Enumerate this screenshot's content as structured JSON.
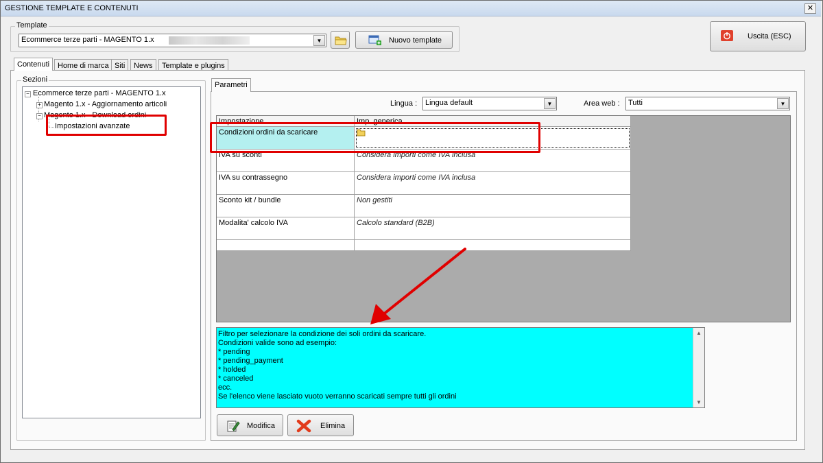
{
  "window": {
    "title": "GESTIONE TEMPLATE E CONTENUTI",
    "close_glyph": "✕"
  },
  "template_group": {
    "legend": "Template",
    "selected": "Ecommerce terze parti - MAGENTO 1.x",
    "new_button": "Nuovo template"
  },
  "exit_button": "Uscita (ESC)",
  "tabs": [
    "Contenuti",
    "Home di marca",
    "Siti",
    "News",
    "Template e plugins"
  ],
  "sections": {
    "legend": "Sezioni",
    "tree": {
      "root": "Ecommerce terze parti - MAGENTO 1.x",
      "child1": "Magento 1.x - Aggiornamento articoli",
      "child2": "Magento 1.x - Download ordini",
      "grandchild": "Impostazioni avanzate"
    }
  },
  "params": {
    "tab": "Parametri",
    "lingua_label": "Lingua :",
    "lingua_value": "Lingua default",
    "area_label": "Area web :",
    "area_value": "Tutti",
    "columns": [
      "Impostazione",
      "Imp. generica"
    ],
    "rows": [
      {
        "name": "Condizioni ordini da scaricare",
        "value": ""
      },
      {
        "name": "IVA su sconti",
        "value": "Considera importi come IVA inclusa"
      },
      {
        "name": "IVA su contrassegno",
        "value": "Considera importi come IVA inclusa"
      },
      {
        "name": "Sconto kit / bundle",
        "value": "Non gestiti"
      },
      {
        "name": "Modalita' calcolo IVA",
        "value": "Calcolo standard (B2B)"
      }
    ],
    "description": [
      "Filtro per selezionare la condizione dei soli ordini da scaricare.",
      "Condizioni valide sono ad esempio:",
      "* pending",
      "* pending_payment",
      "* holded",
      "* canceled",
      "ecc.",
      "Se l'elenco viene lasciato vuoto verranno scaricati sempre tutti gli ordini"
    ],
    "edit_button": "Modifica",
    "delete_button": "Elimina"
  },
  "colors": {
    "highlight": "#e00000",
    "desc_bg": "#00ffff",
    "selected_cell": "#b4f0f0"
  }
}
